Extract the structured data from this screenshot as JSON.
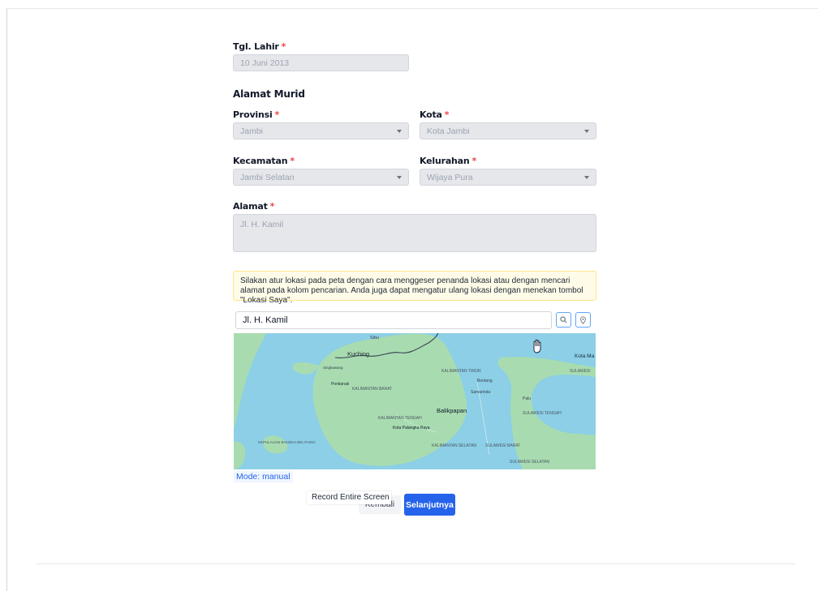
{
  "form": {
    "tgl_lahir_label": "Tgl. Lahir",
    "tgl_lahir_value": "10 Juni 2013",
    "required_mark": "*",
    "section_alamat": "Alamat Murid",
    "provinsi_label": "Provinsi",
    "provinsi_value": "Jambi",
    "kota_label": "Kota",
    "kota_value": "Kota Jambi",
    "kecamatan_label": "Kecamatan",
    "kecamatan_value": "Jambi Selatan",
    "kelurahan_label": "Kelurahan",
    "kelurahan_value": "Wijaya Pura",
    "alamat_label": "Alamat",
    "alamat_value": "Jl. H. Kamil"
  },
  "map": {
    "notice": "Silakan atur lokasi pada peta dengan cara menggeser penanda lokasi atau dengan mencari alamat pada kolom pencarian. Anda juga dapat mengatur ulang lokasi dengan menekan tombol \"Lokasi Saya\".",
    "search_value": "Jl. H. Kamil",
    "mode_text": "Mode: manual",
    "labels": {
      "kuching": "Kuching",
      "sibu": "Sibu",
      "kota_ma": "Kota Ma",
      "pontianak": "Pontianak",
      "kalbar": "KALIMANTAN BARAT",
      "kaltim": "KALIMANTAN TIMUR",
      "kalteng": "KALIMANTAN TENGAH",
      "kalsel": "KALIMANTAN SELATAN",
      "balikpapan": "Balikpapan",
      "palangka": "Kota Palangka Raya",
      "samarinda": "Samarinda",
      "bontang": "Bontang",
      "sulteng": "SULAWESI TENGAH",
      "sulbar": "SULAWESI BARAT",
      "sulsel": "SULAWESI SELATAN",
      "palu": "Palu",
      "bangka": "KEPULAUAN BANGKA BELITUNG",
      "singkawang": "Singkawang",
      "sulawesi": "SULAWESI"
    },
    "water_color": "#8ccfe6",
    "land_color": "#a8dcb0"
  },
  "buttons": {
    "back": "Kembali",
    "next": "Selanjutnya",
    "next_color": "#2563eb"
  },
  "tooltip": {
    "text": "Record Entire Screen"
  }
}
